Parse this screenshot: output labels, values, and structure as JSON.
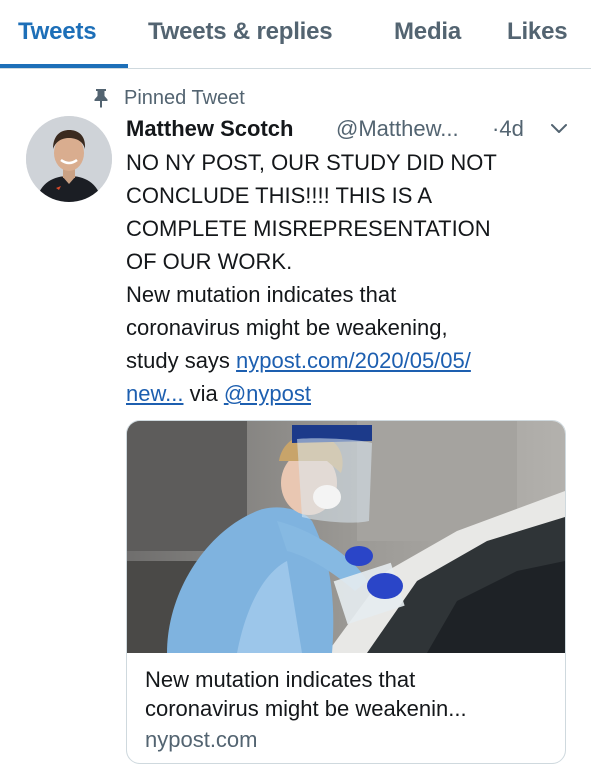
{
  "tabs": [
    {
      "label": "Tweets",
      "active": true
    },
    {
      "label": "Tweets & replies",
      "active": false
    },
    {
      "label": "Media",
      "active": false
    },
    {
      "label": "Likes",
      "active": false
    }
  ],
  "tweet": {
    "pinned_label": "Pinned Tweet",
    "author_name": "Matthew Scotch",
    "author_handle": "@Matthew...",
    "separator": "·",
    "time_ago": "4d",
    "text_lines": [
      "NO NY POST, OUR STUDY DID NOT",
      "CONCLUDE THIS!!!! THIS IS A",
      "COMPLETE MISREPRESENTATION",
      "OF OUR WORK.",
      "New mutation indicates that",
      "coronavirus might be weakening,"
    ],
    "text_study_says": "study says ",
    "link_part1": "nypost.com/2020/05/05/",
    "link_part2": "new...",
    "via_text": " via ",
    "mention": "@nypost"
  },
  "card": {
    "title_line1": "New mutation indicates that",
    "title_line2": "coronavirus might be weakenin...",
    "domain": "nypost.com"
  },
  "icons": {
    "pin": "pin-icon",
    "chevron": "chevron-down-icon"
  },
  "colors": {
    "accent": "#1d6fb8",
    "link": "#1d5fb0",
    "secondary_text": "#536471",
    "border": "#cfd9de"
  }
}
